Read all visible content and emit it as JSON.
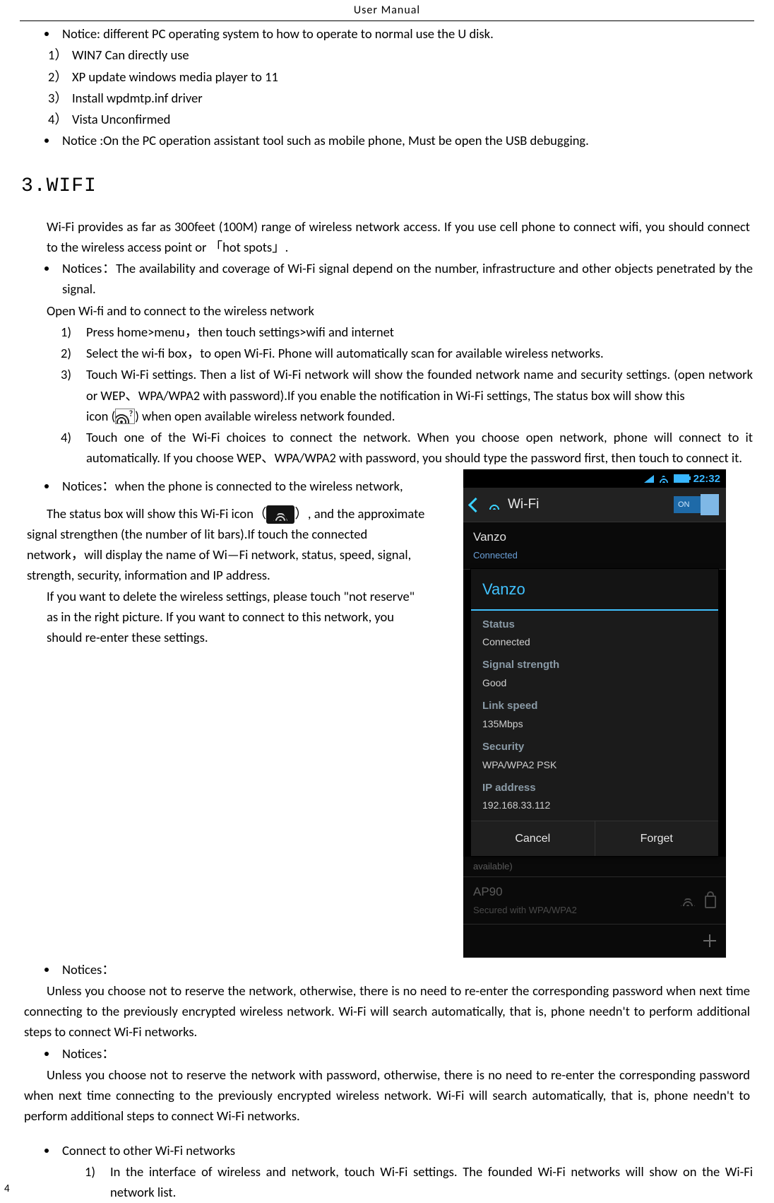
{
  "header": {
    "title": "User  Manual"
  },
  "top_bullets": {
    "bullet1": "Notice: different PC operating system to how to operate to normal use the U disk.",
    "os_list": {
      "i1": "WIN7 Can directly use",
      "i2": "XP update windows media player to 11",
      "i3": "Install  wpdmtp.inf driver",
      "i4": "Vista  Unconfirmed"
    },
    "bullet2": " Notice :On the PC operation assistant tool such as mobile phone, Must be open the USB debugging."
  },
  "section3": {
    "heading": "3.WIFI",
    "intro": "Wi-Fi provides as far as 300feet (100M) range of wireless network access. If you use cell phone to connect wifi, you should connect to the wireless access point or 「hot spots」.",
    "notice_avail": "Notices：The availability and coverage of Wi-Fi signal depend on the number, infrastructure and other objects penetrated by the signal.",
    "open_heading": "Open Wi-fi and to connect to the wireless network",
    "steps": {
      "s1": "Press home>menu，then touch settings>wifi and internet",
      "s2": "Select the wi-fi box，to open Wi-Fi. Phone will automatically scan for available wireless networks.",
      "s3a": "Touch Wi-Fi settings. Then a list of Wi-Fi network will show the founded network name and security settings. (open network or WEP、WPA/WPA2 with password).If you enable the notification in  Wi-Fi settings, The status box will show this",
      "s3b_prefix": "icon (",
      "s3b_suffix": ") when open available wireless network founded.",
      "s4": "Touch one of the Wi-Fi choices to connect the network. When you choose open network, phone will connect to it automatically. If you choose WEP、WPA/WPA2 with password, you should type the password first, then touch to connect it."
    },
    "connected_notice": "Notices：when the phone is connected to the wireless network,",
    "status_icon_prefix": "The status box will show this Wi-Fi icon（",
    "status_icon_suffix": "）, and the approximate",
    "status_lines": {
      "l1": "signal strengthen (the number of lit bars).If touch the connected",
      "l2": "network，will display the name of Wi—Fi  network, status, speed,  signal,",
      "l3": "strength, security, information and IP address.",
      "l4": "If you want to delete the wireless settings, please touch \"not reserve\"",
      "l5": "as in the right picture. If you want to connect to this network, you",
      "l6": "should re-enter these settings."
    },
    "notices_heading": "Notices：",
    "notices_p1": "Unless you choose not to reserve the network, otherwise, there is no need to re-enter the corresponding password when next time connecting to the previously encrypted wireless network. Wi-Fi will search automatically, that is, phone needn't to perform additional steps to connect Wi-Fi networks.",
    "notices_p2": "Unless you choose not to reserve the network with password, otherwise, there is no need to re-enter the corresponding password when next time connecting to the previously encrypted wireless network. Wi-Fi will search automatically, that is, phone needn't to perform additional steps to connect Wi-Fi networks.",
    "connect_other_heading": "Connect to other Wi-Fi networks",
    "connect_other_step1": "In the interface of wireless and network, touch Wi-Fi settings. The founded Wi-Fi networks will show on the Wi-Fi network list."
  },
  "phone": {
    "time": "22:32",
    "screen_title": "Wi-Fi",
    "toggle": "ON",
    "item_vanzo": {
      "title": "Vanzo",
      "sub": "Connected"
    },
    "dialog": {
      "title": "Vanzo",
      "status_l": "Status",
      "status_v": "Connected",
      "signal_l": "Signal strength",
      "signal_v": "Good",
      "link_l": "Link speed",
      "link_v": "135Mbps",
      "security_l": "Security",
      "security_v": "WPA/WPA2 PSK",
      "ip_l": "IP address",
      "ip_v": "192.168.33.112",
      "btn_cancel": "Cancel",
      "btn_forget": "Forget"
    },
    "available_label": "available)",
    "item_ap90": {
      "title": "AP90",
      "sub": "Secured with WPA/WPA2"
    }
  },
  "page_number": "4"
}
